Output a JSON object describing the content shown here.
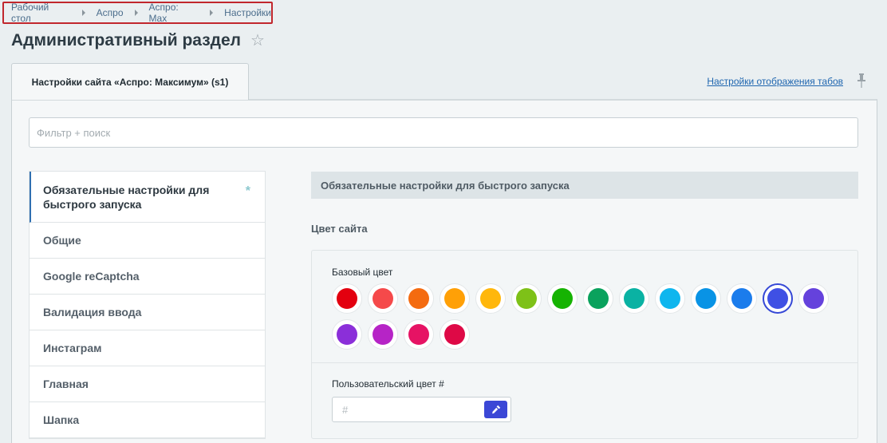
{
  "breadcrumb": [
    "Рабочий стол",
    "Аспро",
    "Аспро: Max",
    "Настройки"
  ],
  "page_title": "Административный раздел",
  "tab": {
    "label": "Настройки сайта «Аспро: Максимум» (s1)",
    "display_settings_link": "Настройки отображения табов"
  },
  "filter": {
    "placeholder": "Фильтр + поиск",
    "value": ""
  },
  "menu": {
    "active": {
      "label": "Обязательные настройки для быстрого запуска",
      "marker": "*"
    },
    "items": [
      "Общие",
      "Google reCaptcha",
      "Валидация ввода",
      "Инстаграм",
      "Главная",
      "Шапка"
    ]
  },
  "content": {
    "section_header": "Обязательные настройки для быстрого запуска",
    "subheading": "Цвет сайта",
    "base_color_label": "Базовый цвет",
    "colors": [
      "#e3000f",
      "#f5494a",
      "#f46b10",
      "#ffa007",
      "#ffb70c",
      "#7ec118",
      "#16b302",
      "#0aa25d",
      "#0ab2a3",
      "#0fb6ee",
      "#0993e5",
      "#1b7cec",
      "#3f50e4",
      "#6542dc",
      "#8b2fd9",
      "#b624c6",
      "#e61364",
      "#de0946"
    ],
    "selected_color_index": 12,
    "custom_color_label": "Пользовательский цвет #",
    "custom_color_placeholder": "#",
    "custom_color_value": ""
  }
}
